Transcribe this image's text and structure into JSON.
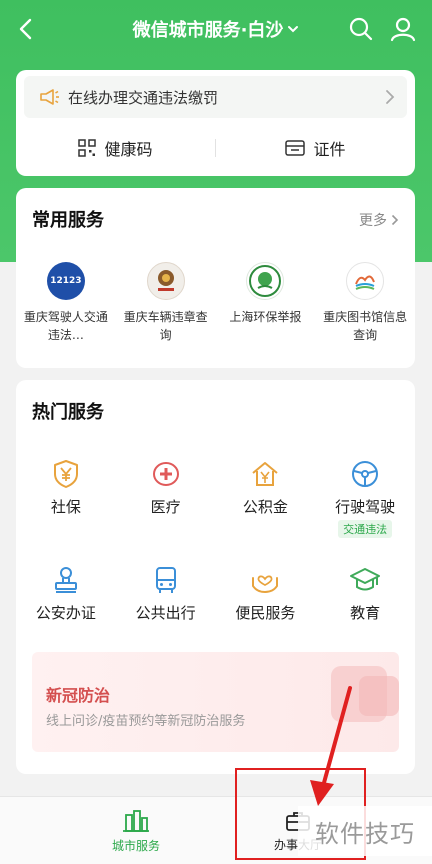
{
  "header": {
    "title": "微信城市服务·白沙",
    "back_icon": "chevron-left-icon",
    "search_icon": "search-icon",
    "user_icon": "user-icon"
  },
  "notice": {
    "text": "在线办理交通违法缴罚"
  },
  "quick": {
    "health_code": "健康码",
    "certificate": "证件"
  },
  "common": {
    "title": "常用服务",
    "more": "更多",
    "items": [
      {
        "label": "重庆驾驶人交通违法…",
        "icon_text": "12123"
      },
      {
        "label": "重庆车辆违章查询",
        "icon_text": "重庆交巡警"
      },
      {
        "label": "上海环保举报"
      },
      {
        "label": "重庆图书馆信息查询"
      }
    ]
  },
  "hot": {
    "title": "热门服务",
    "items": [
      {
        "label": "社保",
        "icon": "yen-shield-icon"
      },
      {
        "label": "医疗",
        "icon": "medical-cross-icon"
      },
      {
        "label": "公积金",
        "icon": "house-yen-icon"
      },
      {
        "label": "行驶驾驶",
        "icon": "steering-wheel-icon",
        "tag": "交通违法"
      },
      {
        "label": "公安办证",
        "icon": "stamp-icon"
      },
      {
        "label": "公共出行",
        "icon": "bus-icon"
      },
      {
        "label": "便民服务",
        "icon": "heart-hands-icon"
      },
      {
        "label": "教育",
        "icon": "graduation-cap-icon"
      }
    ]
  },
  "covid": {
    "title": "新冠防治",
    "subtitle": "线上问诊/疫苗预约等新冠防治服务"
  },
  "tabbar": {
    "city": "城市服务",
    "office": "办事大厅"
  },
  "watermark": "软件技巧",
  "colors": {
    "green": "#3fbf5f",
    "accent_orange": "#e8a33d",
    "accent_red": "#e05a5a",
    "accent_blue": "#3b8fd8",
    "tab_active": "#2ba84a"
  }
}
